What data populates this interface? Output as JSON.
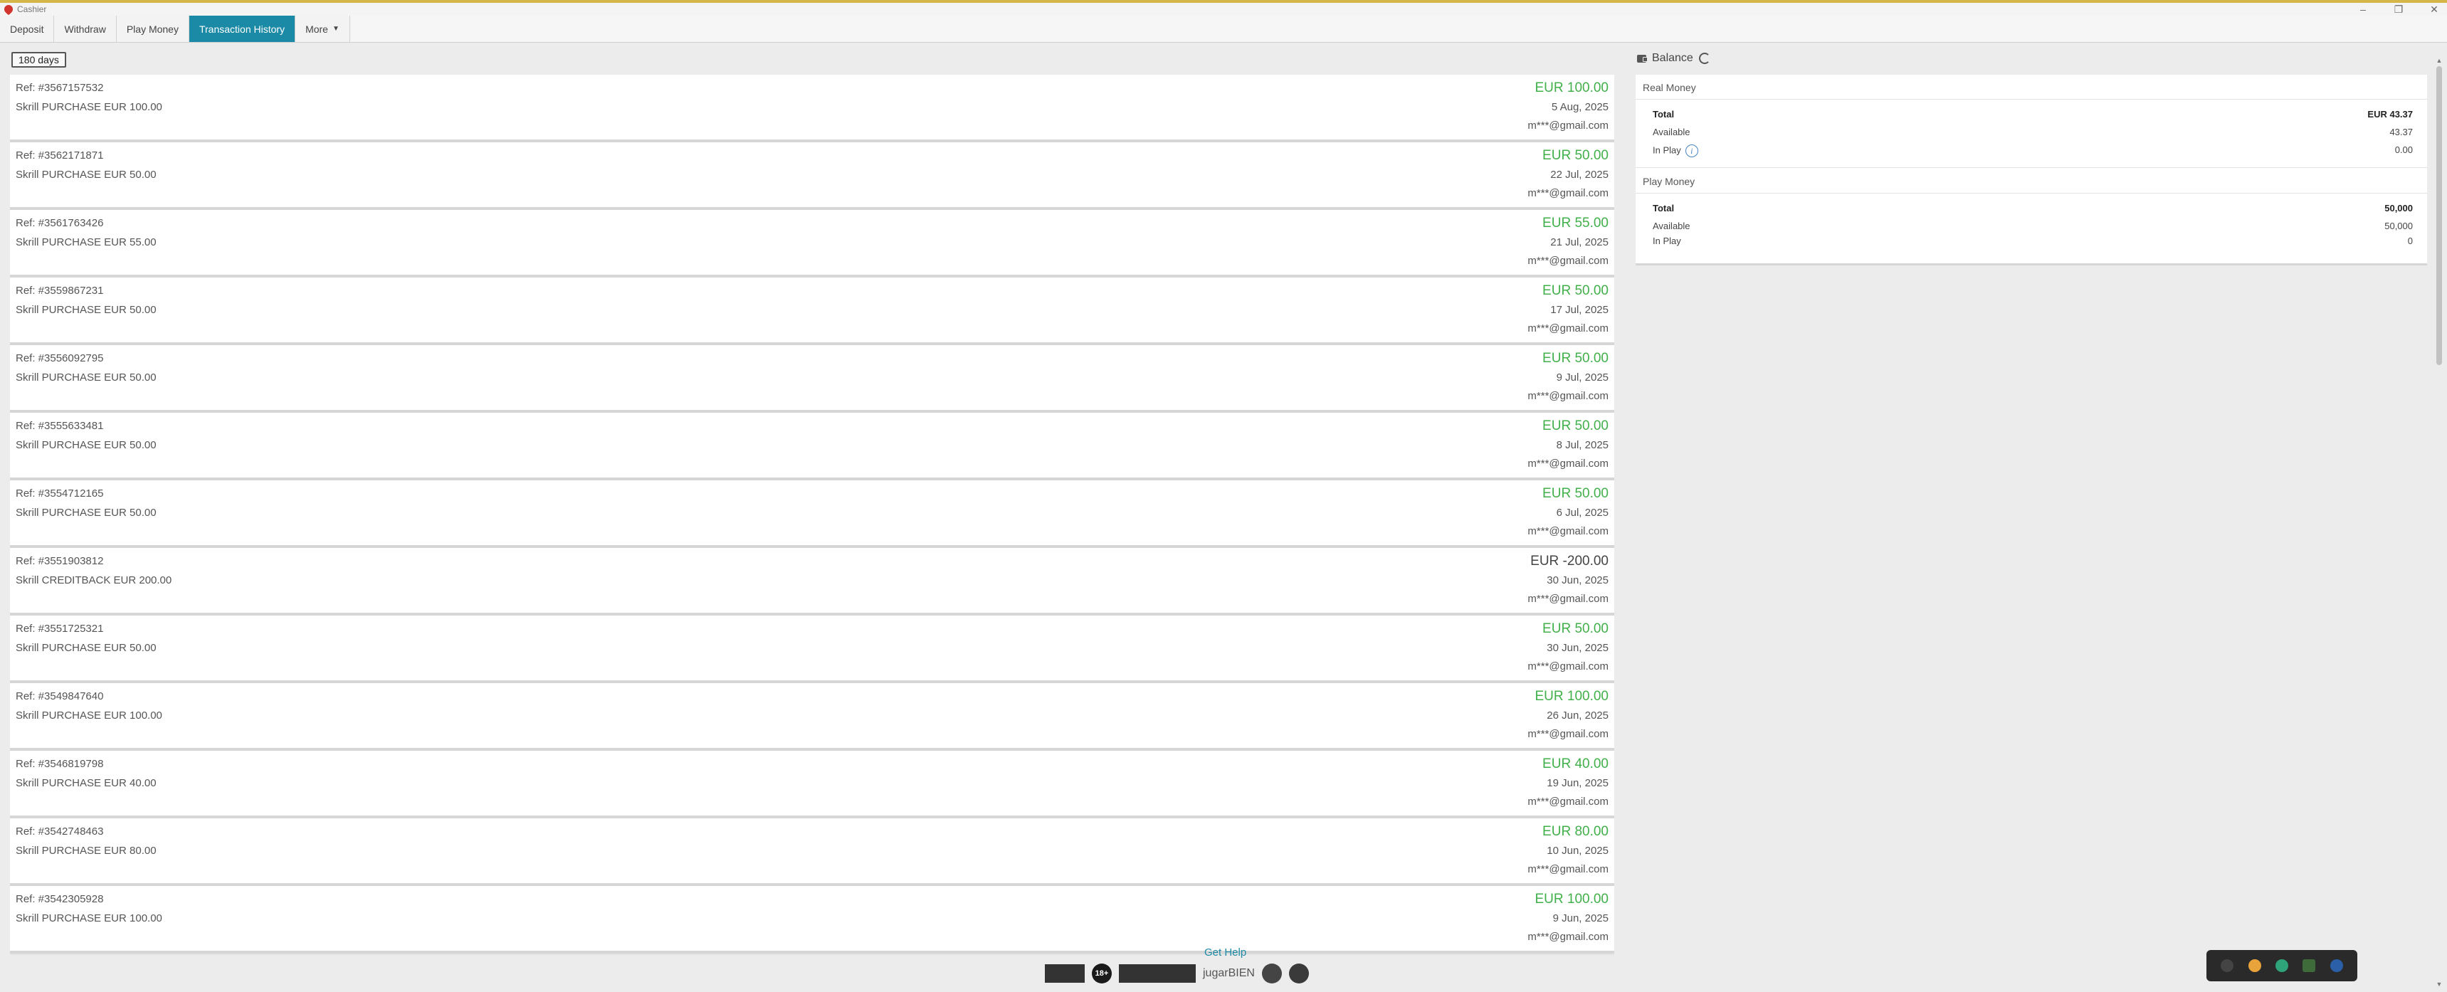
{
  "window": {
    "title": "Cashier"
  },
  "tabs": [
    {
      "label": "Deposit"
    },
    {
      "label": "Withdraw"
    },
    {
      "label": "Play Money"
    },
    {
      "label": "Transaction History"
    },
    {
      "label": "More"
    }
  ],
  "filter": {
    "label": "180 days"
  },
  "transactions": [
    {
      "ref": "Ref: #3567157532",
      "desc": "Skrill PURCHASE EUR 100.00",
      "amount": "EUR 100.00",
      "date": "5 Aug, 2025",
      "email": "m***@gmail.com"
    },
    {
      "ref": "Ref: #3562171871",
      "desc": "Skrill PURCHASE EUR 50.00",
      "amount": "EUR 50.00",
      "date": "22 Jul, 2025",
      "email": "m***@gmail.com"
    },
    {
      "ref": "Ref: #3561763426",
      "desc": "Skrill PURCHASE EUR 55.00",
      "amount": "EUR 55.00",
      "date": "21 Jul, 2025",
      "email": "m***@gmail.com"
    },
    {
      "ref": "Ref: #3559867231",
      "desc": "Skrill PURCHASE EUR 50.00",
      "amount": "EUR 50.00",
      "date": "17 Jul, 2025",
      "email": "m***@gmail.com"
    },
    {
      "ref": "Ref: #3556092795",
      "desc": "Skrill PURCHASE EUR 50.00",
      "amount": "EUR 50.00",
      "date": "9 Jul, 2025",
      "email": "m***@gmail.com"
    },
    {
      "ref": "Ref: #3555633481",
      "desc": "Skrill PURCHASE EUR 50.00",
      "amount": "EUR 50.00",
      "date": "8 Jul, 2025",
      "email": "m***@gmail.com"
    },
    {
      "ref": "Ref: #3554712165",
      "desc": "Skrill PURCHASE EUR 50.00",
      "amount": "EUR 50.00",
      "date": "6 Jul, 2025",
      "email": "m***@gmail.com"
    },
    {
      "ref": "Ref: #3551903812",
      "desc": "Skrill CREDITBACK EUR 200.00",
      "amount": "EUR -200.00",
      "date": "30 Jun, 2025",
      "email": "m***@gmail.com"
    },
    {
      "ref": "Ref: #3551725321",
      "desc": "Skrill PURCHASE EUR 50.00",
      "amount": "EUR 50.00",
      "date": "30 Jun, 2025",
      "email": "m***@gmail.com"
    },
    {
      "ref": "Ref: #3549847640",
      "desc": "Skrill PURCHASE EUR 100.00",
      "amount": "EUR 100.00",
      "date": "26 Jun, 2025",
      "email": "m***@gmail.com"
    },
    {
      "ref": "Ref: #3546819798",
      "desc": "Skrill PURCHASE EUR 40.00",
      "amount": "EUR 40.00",
      "date": "19 Jun, 2025",
      "email": "m***@gmail.com"
    },
    {
      "ref": "Ref: #3542748463",
      "desc": "Skrill PURCHASE EUR 80.00",
      "amount": "EUR 80.00",
      "date": "10 Jun, 2025",
      "email": "m***@gmail.com"
    },
    {
      "ref": "Ref: #3542305928",
      "desc": "Skrill PURCHASE EUR 100.00",
      "amount": "EUR 100.00",
      "date": "9 Jun, 2025",
      "email": "m***@gmail.com"
    }
  ],
  "balance": {
    "title": "Balance",
    "real": {
      "heading": "Real Money",
      "total_label": "Total",
      "total_value": "EUR 43.37",
      "available_label": "Available",
      "available_value": "43.37",
      "inplay_label": "In Play",
      "inplay_value": "0.00"
    },
    "play": {
      "heading": "Play Money",
      "total_label": "Total",
      "total_value": "50,000",
      "available_label": "Available",
      "available_value": "50,000",
      "inplay_label": "In Play",
      "inplay_value": "0"
    }
  },
  "footer": {
    "help_label": "Get Help",
    "age_badge": "18+",
    "brand_text": "jugarBIEN"
  },
  "colors": {
    "accent": "#1b8aa6",
    "positive": "#41b04a",
    "negative": "#444444"
  }
}
